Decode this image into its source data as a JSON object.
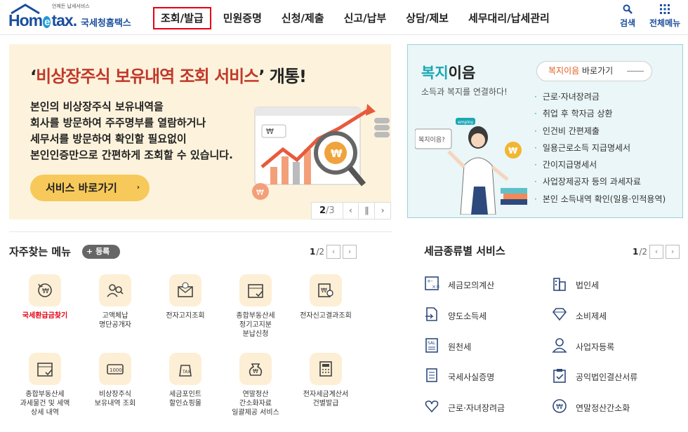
{
  "header": {
    "logo_sub": "언제든 납세서비스",
    "logo_main_a": "Hom",
    "logo_main_e": "e",
    "logo_main_b": "tax.",
    "logo_kor": "국세청홈택스",
    "nav": [
      "조회/발급",
      "민원증명",
      "신청/제출",
      "신고/납부",
      "상담/제보",
      "세무대리/납세관리"
    ],
    "active_nav": "조회/발급",
    "search_label": "검색",
    "menu_label": "전체메뉴"
  },
  "banner": {
    "title_open": "‘",
    "title_red": "비상장주식 보유내역 조회 서비스",
    "title_close": "’",
    "title_tail": "개통!",
    "body": [
      "본인의 비상장주식 보유내역을",
      "회사를 방문하여 주주명부를 열람하거나",
      "세무서를 방문하여 확인할 필요없이",
      "본인인증만으로 간편하게 조회할 수 있습니다."
    ],
    "button": "서비스 바로가기",
    "button_arrow": "›",
    "page_current": "2",
    "page_total": "3",
    "page_sep": "/",
    "won_symbol": "₩",
    "prev": "‹",
    "pause": "∥",
    "next": "›"
  },
  "welfare": {
    "title_a": "복지",
    "title_b": "이음",
    "subtitle": "소득과 복지를 연결하다!",
    "link_red": "복지이음",
    "link_rest": "바로가기",
    "illus_board": "복지이음?",
    "illus_tag": "employ",
    "bullet": "·",
    "items": [
      "근로·자녀장려금",
      "취업 후 학자금 상환",
      "인건비 간편제출",
      "일용근로소득 지급명세서",
      "간이지급명세서",
      "사업장제공자 등의 과세자료",
      "본인 소득내역 확인(일용·인적용역)"
    ]
  },
  "frequent": {
    "title": "자주찾는 메뉴",
    "register_plus": "+",
    "register": "등록",
    "page_current": "1",
    "page_total": "/2",
    "prev": "‹",
    "next": "›",
    "items": [
      {
        "label": "국세환급금찾기",
        "icon": "refund-icon",
        "highlight": true
      },
      {
        "label": "고액체납\n명단공개자",
        "icon": "people-search-icon",
        "highlight": false
      },
      {
        "label": "전자고지조회",
        "icon": "email-notice-icon",
        "highlight": false
      },
      {
        "label": "종합부동산세\n정기고지분\n분납신청",
        "icon": "calendar-check-icon",
        "highlight": false
      },
      {
        "label": "전자신고결과조회",
        "icon": "won-search-icon",
        "highlight": false
      },
      {
        "label": "종합부동산세\n과세물건 및 세액\n상세 내역",
        "icon": "calendar-check-icon",
        "highlight": false
      },
      {
        "label": "비상장주식\n보유내역 조회",
        "icon": "stock-card-icon",
        "highlight": false
      },
      {
        "label": "세금포인트\n할인쇼핑몰",
        "icon": "tax-bag-icon",
        "highlight": false
      },
      {
        "label": "연말정산\n간소화자료\n일괄제공 서비스",
        "icon": "money-bag-icon",
        "highlight": false
      },
      {
        "label": "전자세금계산서\n건별발급",
        "icon": "calculator-doc-icon",
        "highlight": false
      }
    ]
  },
  "tax_services": {
    "title": "세금종류별 서비스",
    "page_current": "1",
    "page_total": "/2",
    "prev": "‹",
    "next": "›",
    "items": [
      {
        "label": "세금모의계산",
        "icon": "calculator-icon"
      },
      {
        "label": "법인세",
        "icon": "building-icon"
      },
      {
        "label": "양도소득세",
        "icon": "document-transfer-icon"
      },
      {
        "label": "소비제세",
        "icon": "diamond-icon"
      },
      {
        "label": "원천세",
        "icon": "receipt-icon"
      },
      {
        "label": "사업자등록",
        "icon": "person-icon"
      },
      {
        "label": "국세사실증명",
        "icon": "certificate-icon"
      },
      {
        "label": "공익법인결산서류",
        "icon": "clipboard-check-icon"
      },
      {
        "label": "근로·자녀장려금",
        "icon": "heart-hands-icon"
      },
      {
        "label": "연말정산간소화",
        "icon": "won-person-icon"
      }
    ]
  },
  "colors": {
    "brand": "#1a4e9c",
    "highlight_border": "#e60012",
    "banner_bg": "#fdf3dc",
    "welfare_bg": "#eaf6f7",
    "accent_teal": "#1aa7b3"
  }
}
